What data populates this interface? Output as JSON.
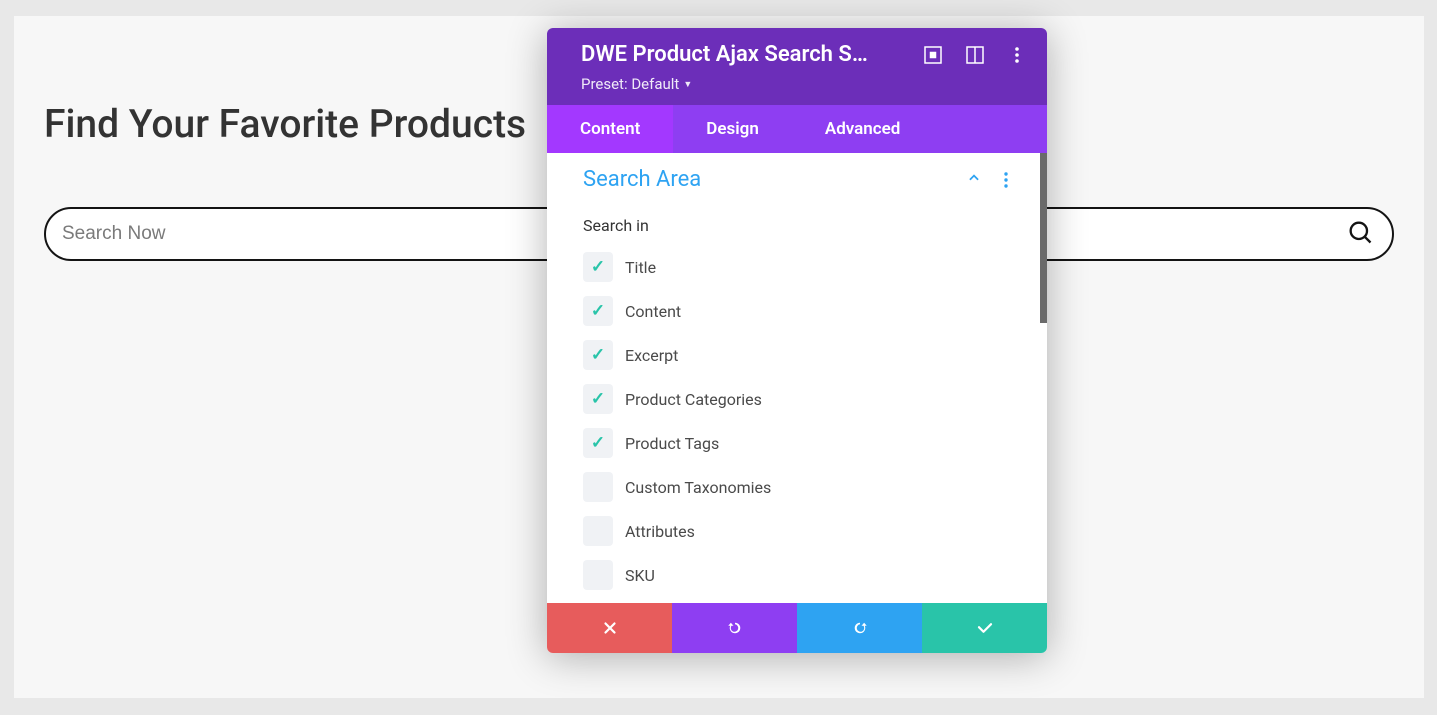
{
  "page": {
    "title": "Find Your Favorite Products",
    "search_placeholder": "Search Now"
  },
  "panel": {
    "title": "DWE Product Ajax Search S…",
    "preset_label": "Preset: Default",
    "tabs": [
      {
        "id": "content",
        "label": "Content",
        "active": true
      },
      {
        "id": "design",
        "label": "Design",
        "active": false
      },
      {
        "id": "advanced",
        "label": "Advanced",
        "active": false
      }
    ],
    "section": {
      "title": "Search Area",
      "field_label": "Search in",
      "items": [
        {
          "label": "Title",
          "checked": true
        },
        {
          "label": "Content",
          "checked": true
        },
        {
          "label": "Excerpt",
          "checked": true
        },
        {
          "label": "Product Categories",
          "checked": true
        },
        {
          "label": "Product Tags",
          "checked": true
        },
        {
          "label": "Custom Taxonomies",
          "checked": false
        },
        {
          "label": "Attributes",
          "checked": false
        },
        {
          "label": "SKU",
          "checked": false
        }
      ]
    }
  }
}
